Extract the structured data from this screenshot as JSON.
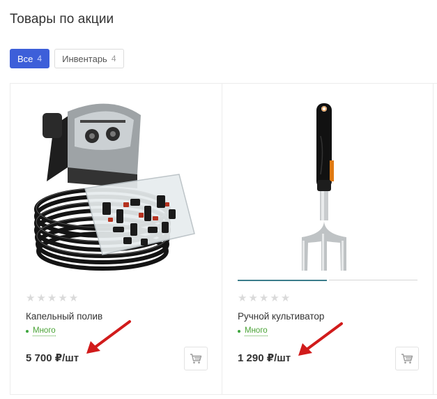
{
  "page": {
    "title": "Товары по акции"
  },
  "filters": [
    {
      "label": "Все",
      "count": "4",
      "active": true
    },
    {
      "label": "Инвентарь",
      "count": "4",
      "active": false
    }
  ],
  "products": [
    {
      "name": "Капельный полив",
      "stock": "Много",
      "price": "5 700 ₽/шт",
      "rating": 0,
      "image": "drip-irrigation-kit"
    },
    {
      "name": "Ручной культиватор",
      "stock": "Много",
      "price": "1 290 ₽/шт",
      "rating": 0,
      "image": "hand-cultivator"
    }
  ],
  "colors": {
    "accent": "#3d5fd9",
    "stock": "#4aa336",
    "annotation_arrow": "#d11b1b"
  }
}
